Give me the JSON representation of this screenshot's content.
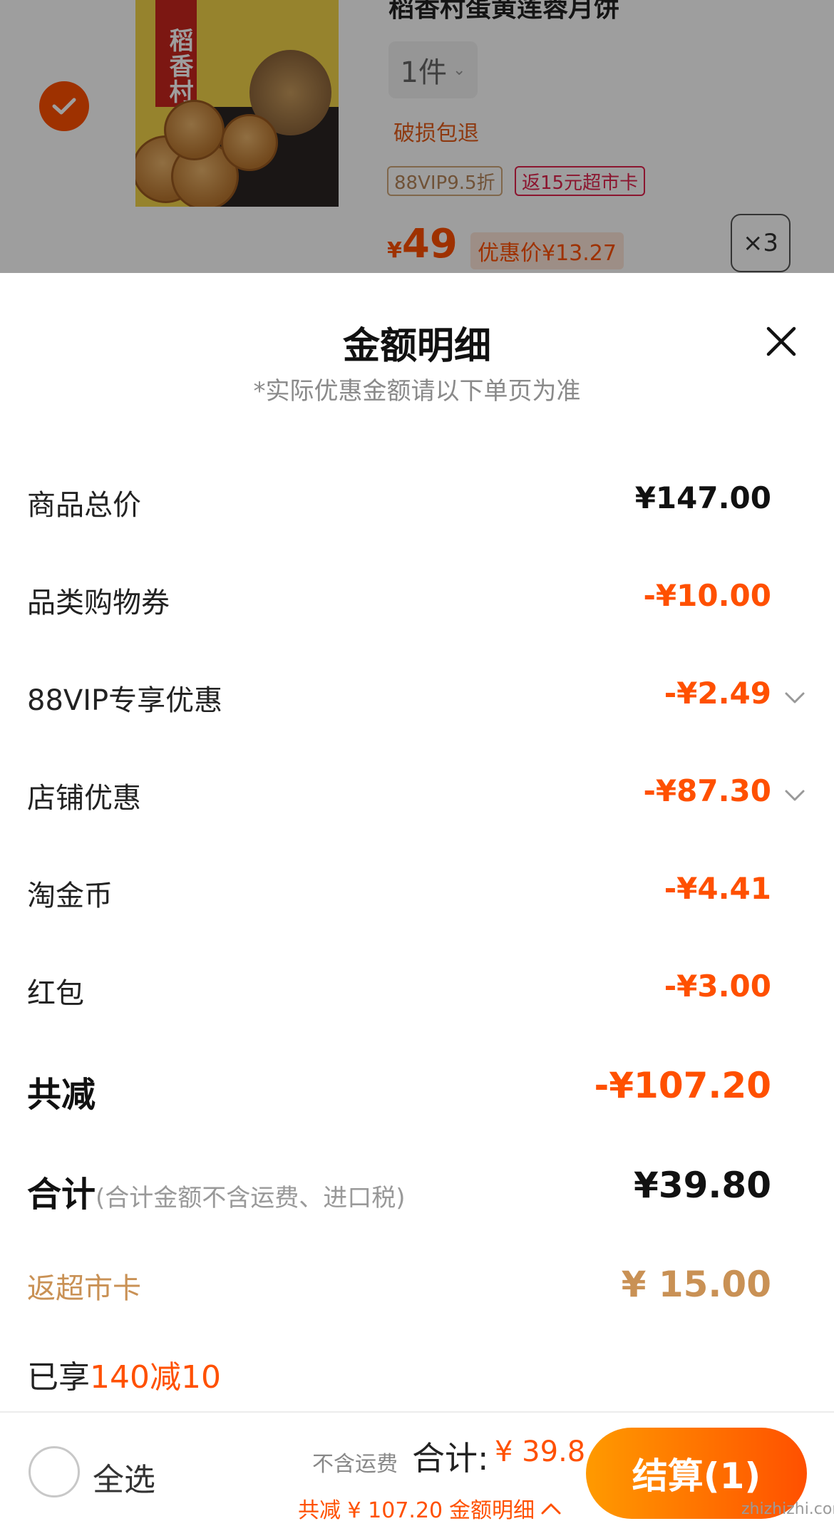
{
  "product": {
    "title": "稻香村蛋黄莲蓉月饼",
    "brand_label": "稻香村",
    "quantity": "1件",
    "return_policy": "破损包退",
    "tag_vip": "88VIP9.5折",
    "tag_card": "返15元超市卡",
    "price_currency": "¥",
    "price": "49",
    "promo_price": "优惠价¥13.27",
    "multiplier": "×3",
    "selected": true
  },
  "sheet": {
    "title": "金额明细",
    "subtitle": "*实际优惠金额请以下单页为准",
    "rows": [
      {
        "label": "商品总价",
        "value": "¥147.00"
      },
      {
        "label": "品类购物券",
        "value": "-¥10.00"
      },
      {
        "label": "88VIP专享优惠",
        "value": "-¥2.49"
      },
      {
        "label": "店铺优惠",
        "value": "-¥87.30"
      },
      {
        "label": "淘金币",
        "value": "-¥4.41"
      },
      {
        "label": "红包",
        "value": "-¥3.00"
      },
      {
        "label": "共减",
        "value": "-¥107.20"
      },
      {
        "label": "合计",
        "note": "(合计金额不含运费、进口税)",
        "value": "¥39.80"
      },
      {
        "label": "返超市卡",
        "value": "¥ 15.00"
      },
      {
        "label": "已享",
        "highlight": "140减10"
      }
    ]
  },
  "bottom_bar": {
    "select_all": "全选",
    "shipping_note": "不含运费",
    "total_label": "合计:",
    "total_value": "¥ 39.8",
    "saved": "共减 ¥ 107.20",
    "detail_link": "金额明细",
    "checkout": "结算(1)"
  },
  "watermark": "zhizhizhi.com",
  "colors": {
    "accent": "#ff5000",
    "gold": "#c99155",
    "tag_red": "#e0224d"
  }
}
